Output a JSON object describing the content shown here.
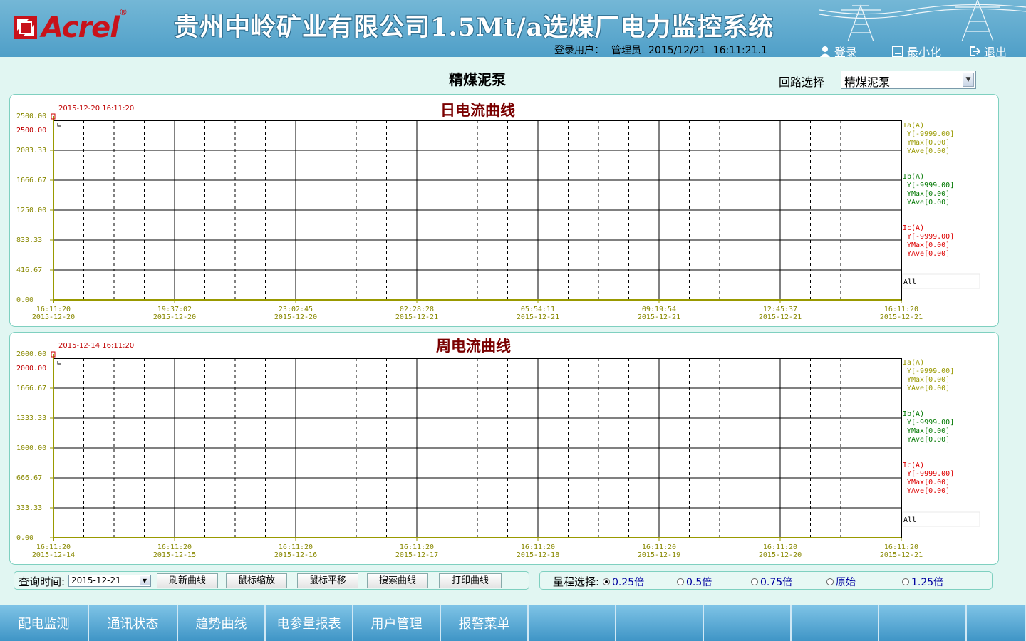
{
  "header": {
    "logo_text": "Acrel",
    "logo_reg": "®",
    "system_title": "贵州中岭矿业有限公司1.5Mt/a选煤厂电力监控系统",
    "user_label": "登录用户：",
    "user_name": "管理员",
    "date": "2015/12/21",
    "time": "16:11:21.1",
    "login_label": "登录",
    "minimize_label": "最小化",
    "exit_label": "退出"
  },
  "page": {
    "title": "精煤泥泵",
    "circuit_label": "回路选择",
    "circuit_value": "精煤泥泵"
  },
  "daily_chart": {
    "title": "日电流曲线",
    "stamp": "2015-12-20 16:11:20",
    "y_max_label": "2500.00",
    "y_max_label_red": "2500.00",
    "yticks": [
      "2083.33",
      "1666.67",
      "1250.00",
      "833.33",
      "416.67",
      "0.00"
    ],
    "xticks": [
      {
        "time": "16:11:20",
        "date": "2015-12-20"
      },
      {
        "time": "19:37:02",
        "date": "2015-12-20"
      },
      {
        "time": "23:02:45",
        "date": "2015-12-20"
      },
      {
        "time": "02:28:28",
        "date": "2015-12-21"
      },
      {
        "time": "05:54:11",
        "date": "2015-12-21"
      },
      {
        "time": "09:19:54",
        "date": "2015-12-21"
      },
      {
        "time": "12:45:37",
        "date": "2015-12-21"
      },
      {
        "time": "16:11:20",
        "date": "2015-12-21"
      }
    ]
  },
  "weekly_chart": {
    "title": "周电流曲线",
    "stamp": "2015-12-14 16:11:20",
    "y_max_label": "2000.00",
    "y_max_label_red": "2000.00",
    "yticks": [
      "1666.67",
      "1333.33",
      "1000.00",
      "666.67",
      "333.33",
      "0.00"
    ],
    "xticks": [
      {
        "time": "16:11:20",
        "date": "2015-12-14"
      },
      {
        "time": "16:11:20",
        "date": "2015-12-15"
      },
      {
        "time": "16:11:20",
        "date": "2015-12-16"
      },
      {
        "time": "16:11:20",
        "date": "2015-12-17"
      },
      {
        "time": "16:11:20",
        "date": "2015-12-18"
      },
      {
        "time": "16:11:20",
        "date": "2015-12-19"
      },
      {
        "time": "16:11:20",
        "date": "2015-12-20"
      },
      {
        "time": "16:11:20",
        "date": "2015-12-21"
      }
    ]
  },
  "legend": [
    {
      "name": "Ia(A)",
      "y": "Y[-9999.00]",
      "ymax": "YMax[0.00]",
      "yave": "YAve[0.00]",
      "color": "#999900"
    },
    {
      "name": "Ib(A)",
      "y": "Y[-9999.00]",
      "ymax": "YMax[0.00]",
      "yave": "YAve[0.00]",
      "color": "#007700"
    },
    {
      "name": "Ic(A)",
      "y": "Y[-9999.00]",
      "ymax": "YMax[0.00]",
      "yave": "YAve[0.00]",
      "color": "#dd0000"
    }
  ],
  "legend_all": "All",
  "chart_data": [
    {
      "type": "line",
      "title": "日电流曲线",
      "xlabel": "",
      "ylabel": "",
      "ylim": [
        0,
        2500
      ],
      "x": [
        "2015-12-20 16:11:20",
        "2015-12-20 19:37:02",
        "2015-12-20 23:02:45",
        "2015-12-21 02:28:28",
        "2015-12-21 05:54:11",
        "2015-12-21 09:19:54",
        "2015-12-21 12:45:37",
        "2015-12-21 16:11:20"
      ],
      "series": [
        {
          "name": "Ia(A)",
          "values": [],
          "y": -9999.0,
          "ymax": 0.0,
          "yave": 0.0
        },
        {
          "name": "Ib(A)",
          "values": [],
          "y": -9999.0,
          "ymax": 0.0,
          "yave": 0.0
        },
        {
          "name": "Ic(A)",
          "values": [],
          "y": -9999.0,
          "ymax": 0.0,
          "yave": 0.0
        }
      ],
      "grid": true,
      "legend": "right"
    },
    {
      "type": "line",
      "title": "周电流曲线",
      "xlabel": "",
      "ylabel": "",
      "ylim": [
        0,
        2000
      ],
      "x": [
        "2015-12-14 16:11:20",
        "2015-12-15 16:11:20",
        "2015-12-16 16:11:20",
        "2015-12-17 16:11:20",
        "2015-12-18 16:11:20",
        "2015-12-19 16:11:20",
        "2015-12-20 16:11:20",
        "2015-12-21 16:11:20"
      ],
      "series": [
        {
          "name": "Ia(A)",
          "values": [],
          "y": -9999.0,
          "ymax": 0.0,
          "yave": 0.0
        },
        {
          "name": "Ib(A)",
          "values": [],
          "y": -9999.0,
          "ymax": 0.0,
          "yave": 0.0
        },
        {
          "name": "Ic(A)",
          "values": [],
          "y": -9999.0,
          "ymax": 0.0,
          "yave": 0.0
        }
      ],
      "grid": true,
      "legend": "right"
    }
  ],
  "controls": {
    "query_label": "查询时间:",
    "query_date": "2015-12-21",
    "buttons": [
      "刷新曲线",
      "鼠标缩放",
      "鼠标平移",
      "搜索曲线",
      "打印曲线"
    ],
    "range_label": "量程选择:",
    "range_options": [
      "0.25倍",
      "0.5倍",
      "0.75倍",
      "原始",
      "1.25倍"
    ],
    "range_selected": "0.25倍"
  },
  "nav": [
    "配电监测",
    "通讯状态",
    "趋势曲线",
    "电参量报表",
    "用户管理",
    "报警菜单",
    "",
    "",
    "",
    "",
    "",
    ""
  ],
  "colors": {
    "header": "#5aa8cf",
    "background": "#e1f6f2",
    "chart_title": "#7a0000",
    "axis": "#999900"
  }
}
